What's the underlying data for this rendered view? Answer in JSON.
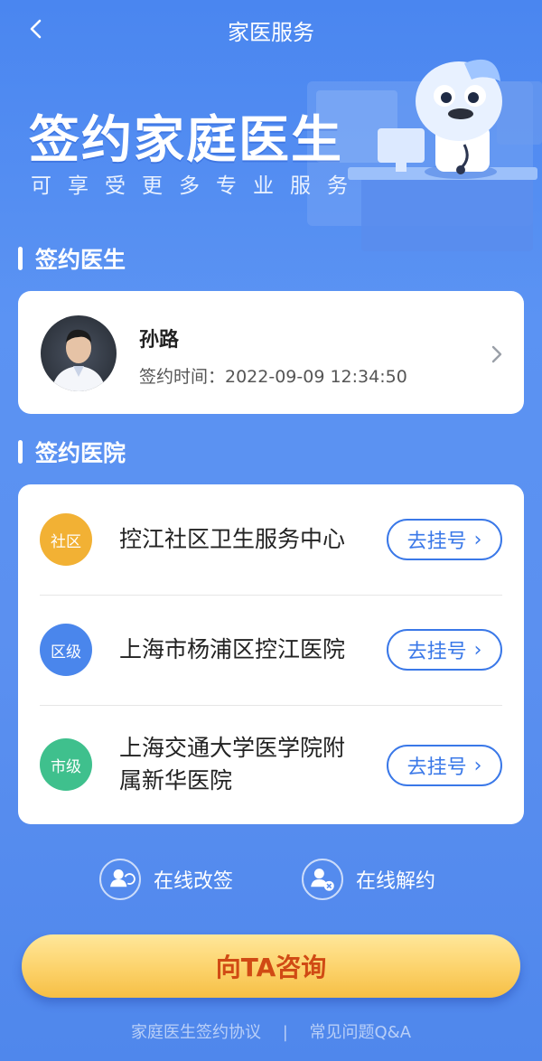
{
  "header": {
    "title": "家医服务"
  },
  "hero": {
    "title": "签约家庭医生",
    "subtitle": "可享受更多专业服务"
  },
  "doctor_section": {
    "heading": "签约医生",
    "doctor": {
      "name": "孙路",
      "sign_time": "签约时间：2022-09-09 12:34:50"
    }
  },
  "hospital_section": {
    "heading": "签约医院",
    "hospitals": [
      {
        "level": "社区",
        "color": "#f2b134",
        "name": "控江社区卫生服务中心",
        "button": "去挂号"
      },
      {
        "level": "区级",
        "color": "#4a86ec",
        "name": "上海市杨浦区控江医院",
        "button": "去挂号"
      },
      {
        "level": "市级",
        "color": "#3fc08d",
        "name_line1": "上海交通大学医学院附",
        "name_line2": "属新华医院",
        "button": "去挂号"
      }
    ]
  },
  "actions": {
    "change": "在线改签",
    "cancel": "在线解约"
  },
  "cta": {
    "label": "向TA咨询"
  },
  "footer": {
    "agreement": "家庭医生签约协议",
    "separator": "|",
    "faq": "常见问题Q&A"
  }
}
